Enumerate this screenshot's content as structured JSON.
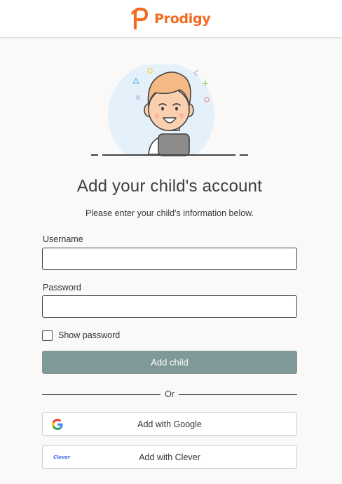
{
  "header": {
    "brand_name": "Prodigy",
    "brand_color": "#f26b21"
  },
  "illustration": {
    "icon": "child-avatar-illustration",
    "bubble_color": "#e4f1fa"
  },
  "main": {
    "title": "Add your child's account",
    "subtitle": "Please enter your child's information below."
  },
  "form": {
    "username_label": "Username",
    "username_value": "",
    "password_label": "Password",
    "password_value": "",
    "show_password_label": "Show password",
    "show_password_checked": false,
    "submit_label": "Add child",
    "submit_color": "#7f9998"
  },
  "divider": {
    "label": "Or"
  },
  "oauth": {
    "google_label": "Add with Google",
    "google_icon": "google-g-icon",
    "clever_label": "Add with Clever",
    "clever_icon_text": "Clever"
  }
}
